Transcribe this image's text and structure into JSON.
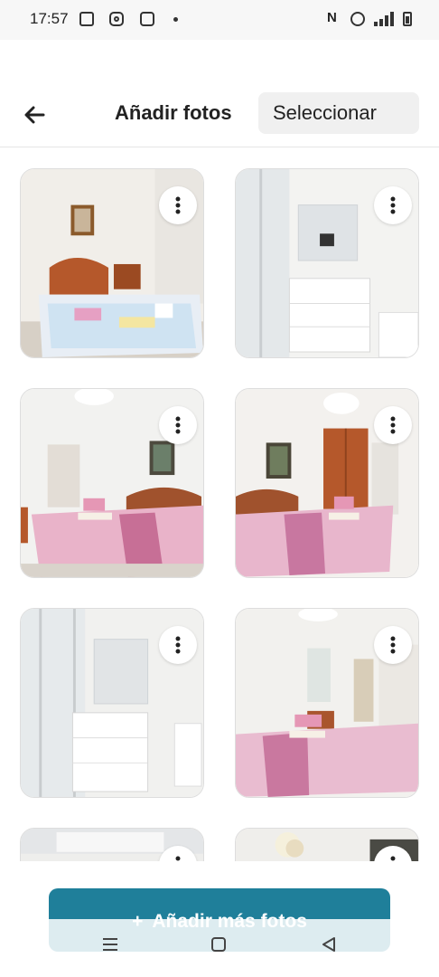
{
  "status_bar": {
    "time": "17:57",
    "icons": [
      "gallery-icon",
      "instagram-icon",
      "square-icon",
      "dot-icon",
      "nfc-icon",
      "alarm-icon",
      "signal-icon",
      "battery-icon"
    ]
  },
  "header": {
    "back_icon": "arrow-left-icon",
    "title": "Añadir fotos",
    "select_label": "Seleccionar"
  },
  "photos": [
    {
      "name": "bedroom-wooden-headboard",
      "menu_icon": "more-vertical-icon"
    },
    {
      "name": "bathroom-shower-mirror",
      "menu_icon": "more-vertical-icon"
    },
    {
      "name": "bedroom-pink-bedspread",
      "menu_icon": "more-vertical-icon"
    },
    {
      "name": "bedroom-pink-bedspread-wardrobe",
      "menu_icon": "more-vertical-icon"
    },
    {
      "name": "bathroom-vanity-shower",
      "menu_icon": "more-vertical-icon"
    },
    {
      "name": "bedroom-pink-window",
      "menu_icon": "more-vertical-icon"
    },
    {
      "name": "photo-partial-7",
      "menu_icon": "more-vertical-icon"
    },
    {
      "name": "photo-partial-8",
      "menu_icon": "more-vertical-icon"
    }
  ],
  "footer": {
    "add_more_label": "Añadir más fotos",
    "add_more_icon": "plus-icon"
  },
  "nav_bar": {
    "icons": [
      "menu-icon",
      "home-icon",
      "back-triangle-icon"
    ]
  },
  "colors": {
    "accent": "#1f7f9a",
    "pink_bedspread": "#d98fb0",
    "wood": "#b5582b"
  }
}
